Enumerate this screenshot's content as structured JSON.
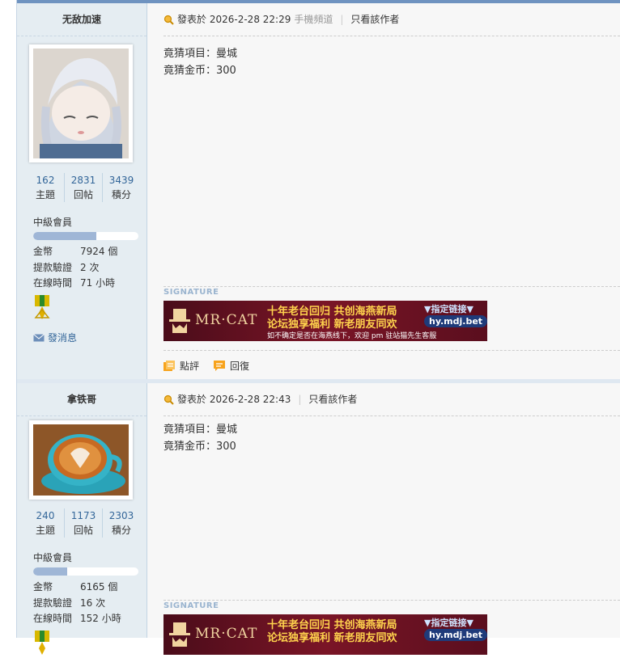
{
  "posts": [
    {
      "author": "无敌加速",
      "stats": [
        {
          "value": "162",
          "label": "主題"
        },
        {
          "value": "2831",
          "label": "回帖"
        },
        {
          "value": "3439",
          "label": "積分"
        }
      ],
      "rank": "中級會員",
      "rank_progress": 0.6,
      "info": [
        {
          "key": "金幣",
          "value": "7924 個"
        },
        {
          "key": "提款驗證",
          "value": "2 次"
        },
        {
          "key": "在線時間",
          "value": "71 小時"
        }
      ],
      "send_message": "發消息",
      "posted_label": "發表於",
      "time": "2026-2-28 22:29",
      "channel": "手機頻道",
      "only_author": "只看該作者",
      "lines": [
        "竟猜項目：曼城",
        "竟猜金币：300"
      ],
      "signature_label": "SIGNATURE",
      "actions": {
        "rate": "點評",
        "reply": "回復"
      }
    },
    {
      "author": "拿铁哥",
      "stats": [
        {
          "value": "240",
          "label": "主題"
        },
        {
          "value": "1173",
          "label": "回帖"
        },
        {
          "value": "2303",
          "label": "積分"
        }
      ],
      "rank": "中級會員",
      "rank_progress": 0.32,
      "info": [
        {
          "key": "金幣",
          "value": "6165 個"
        },
        {
          "key": "提款驗證",
          "value": "16 次"
        },
        {
          "key": "在線時間",
          "value": "152 小時"
        }
      ],
      "posted_label": "發表於",
      "time": "2026-2-28 22:43",
      "only_author": "只看該作者",
      "lines": [
        "竟猜項目：曼城",
        "竟猜金币：300"
      ],
      "signature_label": "SIGNATURE"
    }
  ],
  "banner": {
    "brand": "MR·CAT",
    "line1": "十年老台回归 共创海燕新局",
    "line2": "论坛独享福利 新老朋友同欢",
    "line3": "如不确定是否在海燕线下，欢迎 pm 驻站猫先生客服",
    "tag1": "▼指定链接▼",
    "tag2": "hy.mdj.bet"
  },
  "colors": {
    "accent": "#336699",
    "topbar": "#6f93c0",
    "sidebar": "#e5edf2",
    "content": "#f7f7f7"
  }
}
